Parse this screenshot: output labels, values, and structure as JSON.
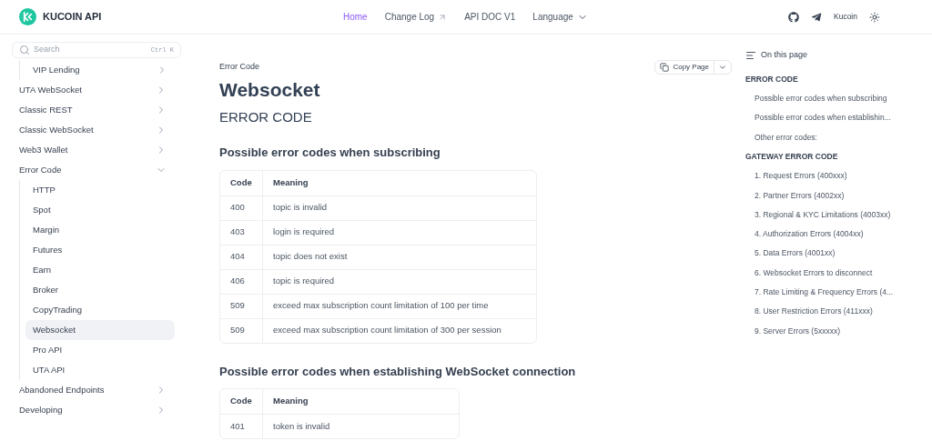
{
  "header": {
    "logo_text": "KUCOIN API",
    "nav": [
      {
        "label": "Home",
        "selected": true,
        "kind": "link"
      },
      {
        "label": "Change Log",
        "selected": false,
        "kind": "external"
      },
      {
        "label": "API DOC V1",
        "selected": false,
        "kind": "link"
      },
      {
        "label": "Language",
        "selected": false,
        "kind": "dropdown"
      }
    ],
    "account": "Kucoin"
  },
  "sidebar": {
    "search": {
      "placeholder": "Search",
      "shortcut": "Ctrl K"
    },
    "items": [
      {
        "children": [
          {
            "label": "VIP Lending",
            "expanded": false,
            "selected": false
          }
        ]
      },
      {
        "label": "UTA WebSocket",
        "expanded": false
      },
      {
        "label": "Classic REST",
        "expanded": false
      },
      {
        "label": "Classic WebSocket",
        "expanded": false
      },
      {
        "label": "Web3 Wallet",
        "expanded": false
      },
      {
        "label": "Error Code",
        "expanded": true,
        "children": [
          {
            "label": "HTTP",
            "selected": false
          },
          {
            "label": "Spot",
            "selected": false
          },
          {
            "label": "Margin",
            "selected": false
          },
          {
            "label": "Futures",
            "selected": false
          },
          {
            "label": "Earn",
            "selected": false
          },
          {
            "label": "Broker",
            "selected": false
          },
          {
            "label": "CopyTrading",
            "selected": false
          },
          {
            "label": "Websocket",
            "selected": true
          },
          {
            "label": "Pro API",
            "selected": false
          },
          {
            "label": "UTA API",
            "selected": false
          }
        ]
      },
      {
        "label": "Abandoned Endpoints",
        "expanded": false
      },
      {
        "label": "Developing",
        "expanded": false
      }
    ]
  },
  "main": {
    "breadcrumb": "Error Code",
    "copy_button": "Copy Page",
    "title": "Websocket",
    "section_title": "ERROR CODE",
    "tables": [
      {
        "heading": "Possible error codes when subscribing",
        "columns": [
          "Code",
          "Meaning"
        ],
        "rows": [
          [
            "400",
            "topic is invalid"
          ],
          [
            "403",
            "login is required"
          ],
          [
            "404",
            "topic does not exist"
          ],
          [
            "406",
            "topic is required"
          ],
          [
            "509",
            "exceed max subscription count limitation of 100 per time"
          ],
          [
            "509",
            "exceed max subscription count limitation of 300 per session"
          ]
        ]
      },
      {
        "heading": "Possible error codes when establishing WebSocket connection",
        "columns": [
          "Code",
          "Meaning"
        ],
        "rows": [
          [
            "401",
            "token is invalid"
          ]
        ]
      }
    ]
  },
  "toc": {
    "title": "On this page",
    "items": [
      {
        "label": "ERROR CODE",
        "kind": "heading"
      },
      {
        "label": "Possible error codes when subscribing",
        "kind": "sub"
      },
      {
        "label": "Possible error codes when establishin...",
        "kind": "sub"
      },
      {
        "label": "Other error codes:",
        "kind": "sub"
      },
      {
        "label": "GATEWAY ERROR CODE",
        "kind": "heading"
      },
      {
        "label": "1. Request Errors (400xxx)",
        "kind": "sub"
      },
      {
        "label": "2. Partner Errors (4002xx)",
        "kind": "sub"
      },
      {
        "label": "3. Regional & KYC Limitations (4003xx)",
        "kind": "sub"
      },
      {
        "label": "4. Authorization Errors (4004xx)",
        "kind": "sub"
      },
      {
        "label": "5. Data Errors (4001xx)",
        "kind": "sub"
      },
      {
        "label": "6. Websocket Errors to disconnect",
        "kind": "sub"
      },
      {
        "label": "7. Rate Limiting & Frequency Errors (4...",
        "kind": "sub"
      },
      {
        "label": "8. User Restriction Errors (411xxx)",
        "kind": "sub"
      },
      {
        "label": "9. Server Errors (5xxxxx)",
        "kind": "sub"
      }
    ]
  }
}
